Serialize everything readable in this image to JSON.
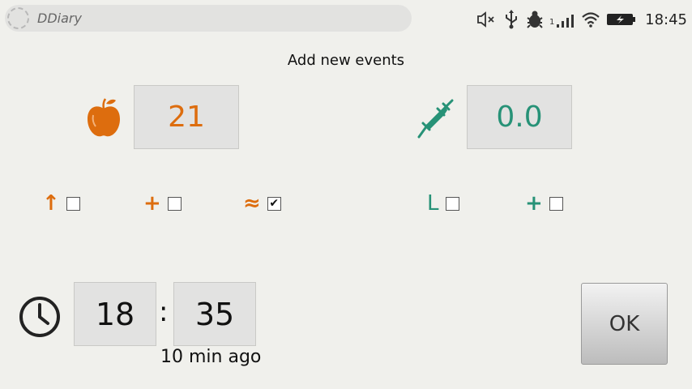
{
  "statusbar": {
    "app_name": "DDiary",
    "time": "18:45",
    "signal_sim": "1",
    "icons": [
      "mute-icon",
      "usb-icon",
      "bug-icon",
      "signal-icon",
      "wifi-icon",
      "battery-icon"
    ]
  },
  "page": {
    "title": "Add new events"
  },
  "carbs": {
    "value": "21",
    "icon": "apple-icon",
    "color": "#dd6d0e"
  },
  "insulin": {
    "value": "0.0",
    "icon": "syringe-icon",
    "color": "#279277"
  },
  "flags": [
    {
      "symbol": "↑",
      "checked": false
    },
    {
      "symbol": "+",
      "checked": false
    },
    {
      "symbol": "≈",
      "checked": true
    },
    {
      "symbol": "L",
      "checked": false
    },
    {
      "symbol": "+",
      "checked": false
    }
  ],
  "time": {
    "hour": "18",
    "minute": "35",
    "separator": ":",
    "relative": "10 min ago",
    "icon": "clock-icon"
  },
  "ok_button": {
    "label": "OK"
  }
}
